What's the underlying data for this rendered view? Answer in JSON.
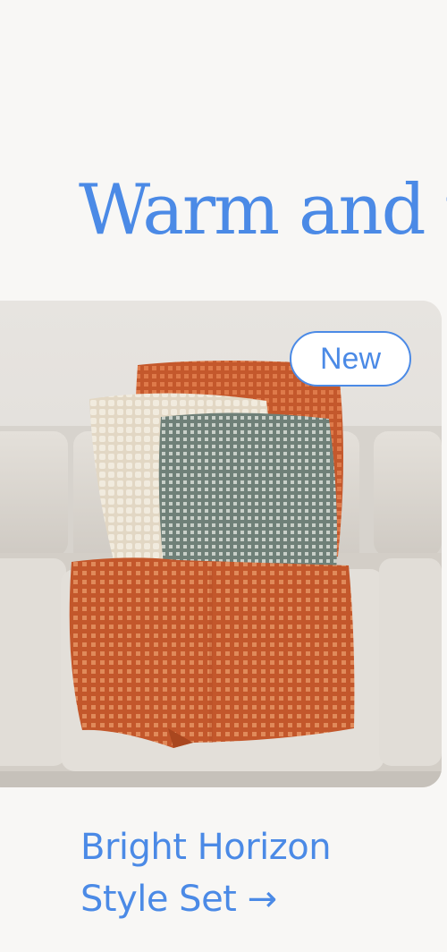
{
  "hero": {
    "headline": "Warm and t"
  },
  "product_card": {
    "badge_label": "New",
    "image_icon": "sofa-with-pillows-and-throw-photo",
    "link_line1": "Bright Horizon",
    "link_line2": "Style Set →"
  },
  "colors": {
    "accent": "#4b8ae6",
    "page_background": "#f8f7f5",
    "terracotta": "#c85a2e",
    "cream": "#ece3d2",
    "sage": "#8a9a92",
    "sofa": "#ddd9d4"
  }
}
